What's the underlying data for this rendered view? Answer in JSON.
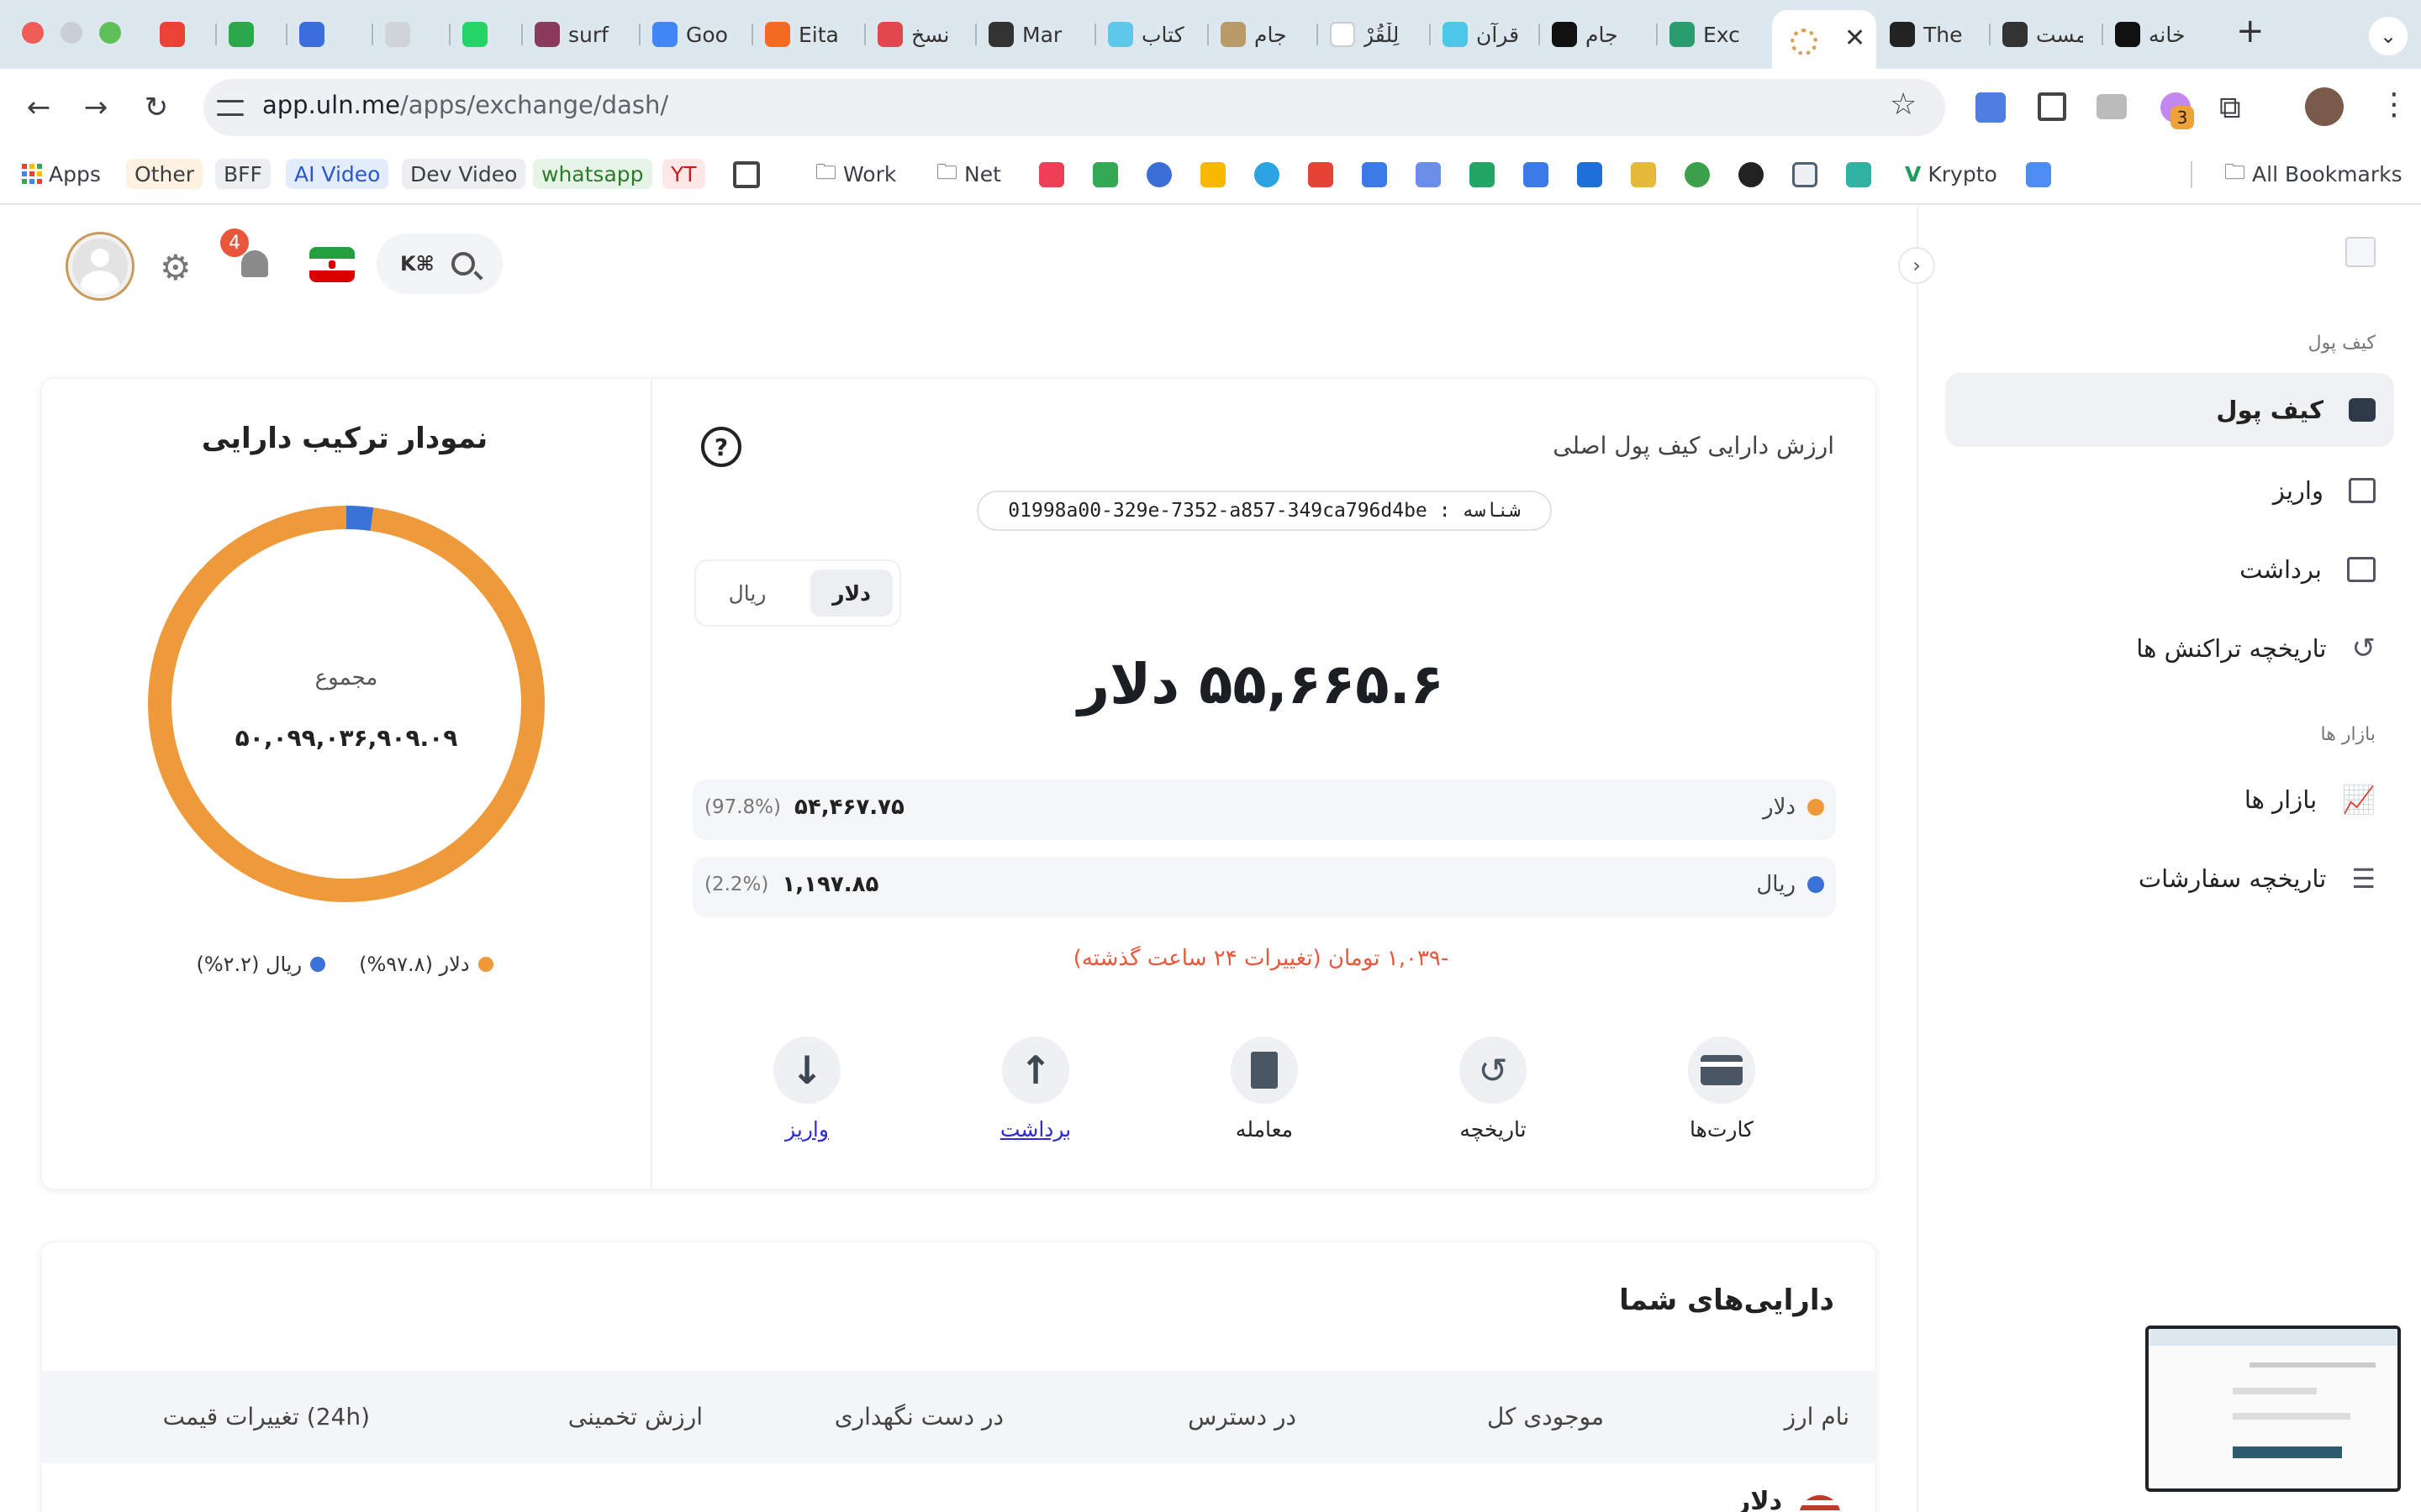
{
  "browser": {
    "tabs": [
      {
        "title": "",
        "icon": "gmail-icon"
      },
      {
        "title": "",
        "icon": "shield-check-icon"
      },
      {
        "title": "",
        "icon": "chat-bubble-icon"
      },
      {
        "title": "",
        "icon": "openai-icon"
      },
      {
        "title": "",
        "icon": "whatsapp-icon"
      },
      {
        "title": "surf",
        "icon": "hat-icon"
      },
      {
        "title": "Goo",
        "icon": "gemini-icon"
      },
      {
        "title": "Eita",
        "icon": "eitaa-icon"
      },
      {
        "title": "نسخ",
        "icon": "circle-app-icon"
      },
      {
        "title": "Mar",
        "icon": "dark-circle-icon"
      },
      {
        "title": "کتاب",
        "icon": "book-icon"
      },
      {
        "title": "جام",
        "icon": "colorful-icon"
      },
      {
        "title": "لِلْقُرْ",
        "icon": "google-icon"
      },
      {
        "title": "قرآن",
        "icon": "quran-icon"
      },
      {
        "title": "جام",
        "icon": "x-icon"
      },
      {
        "title": "Exc",
        "icon": "exchange-icon"
      },
      {
        "title": "",
        "icon": "spinner-icon"
      },
      {
        "title": "The",
        "icon": "hbr-icon"
      },
      {
        "title": "مست",
        "icon": "dark-circle-icon"
      },
      {
        "title": "خانه",
        "icon": "x-icon"
      }
    ],
    "url_host": "app.uln.me",
    "url_path": "/apps/exchange/dash/",
    "extension_badge": "3",
    "bookmarks": [
      {
        "label": "Apps"
      },
      {
        "label": "Other"
      },
      {
        "label": "BFF"
      },
      {
        "label": "AI Video"
      },
      {
        "label": "Dev Video"
      },
      {
        "label": "whatsapp"
      },
      {
        "label": "YT"
      },
      {
        "label": "Work"
      },
      {
        "label": "Net"
      },
      {
        "label": "Krypto"
      },
      {
        "label": "All Bookmarks"
      }
    ]
  },
  "header": {
    "search_shortcut": "K⌘",
    "notification_count": "4"
  },
  "sidebar": {
    "section_wallet": "کیف پول",
    "items_wallet": [
      {
        "label": "کیف پول",
        "icon": "wallet-icon",
        "active": true
      },
      {
        "label": "واریز",
        "icon": "deposit-icon",
        "active": false
      },
      {
        "label": "برداشت",
        "icon": "withdraw-icon",
        "active": false
      },
      {
        "label": "تاریخچه تراکنش ها",
        "icon": "history-icon",
        "active": false
      }
    ],
    "section_markets": "بازار ها",
    "items_markets": [
      {
        "label": "بازار ها",
        "icon": "chart-line-icon",
        "active": false
      },
      {
        "label": "تاریخچه سفارشات",
        "icon": "list-check-icon",
        "active": false
      }
    ]
  },
  "wallet": {
    "title": "ارزش دارایی کیف پول اصلی",
    "id_label": "شناسه :",
    "id_value": "01998a00-329e-7352-a857-349ca796d4be",
    "currency_toggle": [
      "دلار",
      "ریال"
    ],
    "selected_currency": "دلار",
    "total": "۵۵,۶۶۵.۶ دلار",
    "rows": [
      {
        "name": "دلار",
        "value": "۵۴,۴۶۷.۷۵",
        "percent": "(97.8%)",
        "color": "#ee9a3a"
      },
      {
        "name": "ریال",
        "value": "۱,۱۹۷.۸۵",
        "percent": "(2.2%)",
        "color": "#3a72d8"
      }
    ],
    "change_text": "-۱,۰۳۹ تومان (تغییرات ۲۴ ساعت گذشته)",
    "actions": [
      {
        "label": "کارت‌ها",
        "icon": "card-icon",
        "link": false
      },
      {
        "label": "تاریخچه",
        "icon": "history-icon",
        "link": false
      },
      {
        "label": "معامله",
        "icon": "receipt-icon",
        "link": false
      },
      {
        "label": "برداشت",
        "icon": "arrow-up-icon",
        "link": true
      },
      {
        "label": "واریز",
        "icon": "arrow-down-icon",
        "link": true
      }
    ]
  },
  "composition": {
    "title": "نمودار ترکیب دارایی",
    "center_label": "مجموع",
    "center_value": "۵۰,۰۹۹,۰۳۶,۹۰۹.۰۹",
    "legend": [
      {
        "label": "دلار (۹۷.۸%)",
        "color": "#ee9a3a"
      },
      {
        "label": "ریال (۲.۲%)",
        "color": "#3a72d8"
      }
    ]
  },
  "chart_data": {
    "type": "pie",
    "categories": [
      "دلار",
      "ریال"
    ],
    "values": [
      97.8,
      2.2
    ],
    "colors": [
      "#ee9a3a",
      "#3a72d8"
    ],
    "title": "نمودار ترکیب دارایی"
  },
  "assets": {
    "title": "دارایی‌های شما",
    "columns": [
      "نام ارز",
      "موجودی کل",
      "در دسترس",
      "در دست نگهداری",
      "ارزش تخمینی",
      "تغییرات قیمت (24h)"
    ],
    "first_row_name": "دلار"
  }
}
